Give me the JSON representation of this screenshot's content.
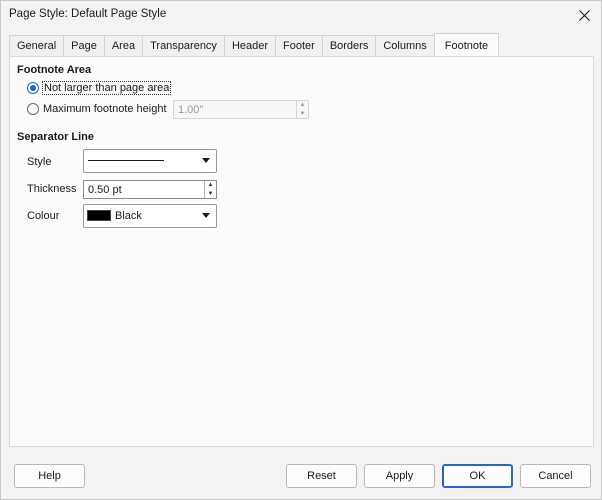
{
  "window": {
    "title": "Page Style: Default Page Style"
  },
  "tabs": [
    {
      "label": "General",
      "active": false
    },
    {
      "label": "Page",
      "active": false
    },
    {
      "label": "Area",
      "active": false
    },
    {
      "label": "Transparency",
      "active": false
    },
    {
      "label": "Header",
      "active": false
    },
    {
      "label": "Footer",
      "active": false
    },
    {
      "label": "Borders",
      "active": false
    },
    {
      "label": "Columns",
      "active": false
    },
    {
      "label": "Footnote",
      "active": true
    }
  ],
  "footnote_area": {
    "title": "Footnote Area",
    "option_not_larger": "Not larger than page area",
    "option_max_height": "Maximum footnote height",
    "max_height_value": "1.00\"",
    "selected": "not_larger"
  },
  "separator_line": {
    "title": "Separator Line",
    "style_label": "Style",
    "thickness_label": "Thickness",
    "thickness_value": "0.50 pt",
    "colour_label": "Colour",
    "colour_value": "Black",
    "colour_hex": "#000000"
  },
  "buttons": {
    "help": "Help",
    "reset": "Reset",
    "apply": "Apply",
    "ok": "OK",
    "cancel": "Cancel"
  }
}
